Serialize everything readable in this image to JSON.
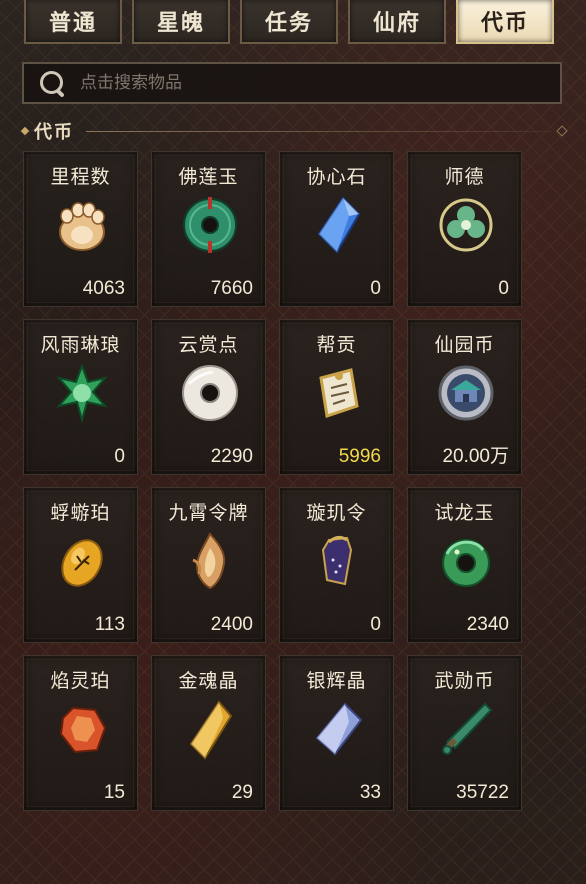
{
  "tabs": [
    {
      "label": "普通",
      "active": false
    },
    {
      "label": "星魄",
      "active": false
    },
    {
      "label": "任务",
      "active": false
    },
    {
      "label": "仙府",
      "active": false
    },
    {
      "label": "代币",
      "active": true
    }
  ],
  "search": {
    "placeholder": "点击搜索物品",
    "value": ""
  },
  "section": {
    "title": "代币"
  },
  "items": [
    {
      "name": "里程数",
      "count": "4063",
      "icon": "paw-icon"
    },
    {
      "name": "佛莲玉",
      "count": "7660",
      "icon": "jade-disc-icon"
    },
    {
      "name": "协心石",
      "count": "0",
      "icon": "blue-crystal-icon"
    },
    {
      "name": "师德",
      "count": "0",
      "icon": "clover-emblem-icon"
    },
    {
      "name": "风雨琳琅",
      "count": "0",
      "icon": "green-flower-gem-icon"
    },
    {
      "name": "云赏点",
      "count": "2290",
      "icon": "white-jade-ring-icon"
    },
    {
      "name": "帮贡",
      "count": "5996",
      "icon": "scroll-badge-icon",
      "highlight": true
    },
    {
      "name": "仙园币",
      "count": "20.00万",
      "icon": "pavilion-coin-icon"
    },
    {
      "name": "蜉蝣珀",
      "count": "113",
      "icon": "amber-insect-icon"
    },
    {
      "name": "九霄令牌",
      "count": "2400",
      "icon": "flame-token-icon"
    },
    {
      "name": "璇玑令",
      "count": "0",
      "icon": "purple-pouch-icon"
    },
    {
      "name": "试龙玉",
      "count": "2340",
      "icon": "dragon-jade-icon"
    },
    {
      "name": "焰灵珀",
      "count": "15",
      "icon": "fire-amber-icon"
    },
    {
      "name": "金魂晶",
      "count": "29",
      "icon": "gold-crystal-icon"
    },
    {
      "name": "银辉晶",
      "count": "33",
      "icon": "silver-crystal-icon"
    },
    {
      "name": "武勋币",
      "count": "35722",
      "icon": "green-blade-icon"
    }
  ],
  "colors": {
    "highlight": "#f2d84a",
    "accent": "#c9a96a",
    "text": "#f3ead6"
  }
}
